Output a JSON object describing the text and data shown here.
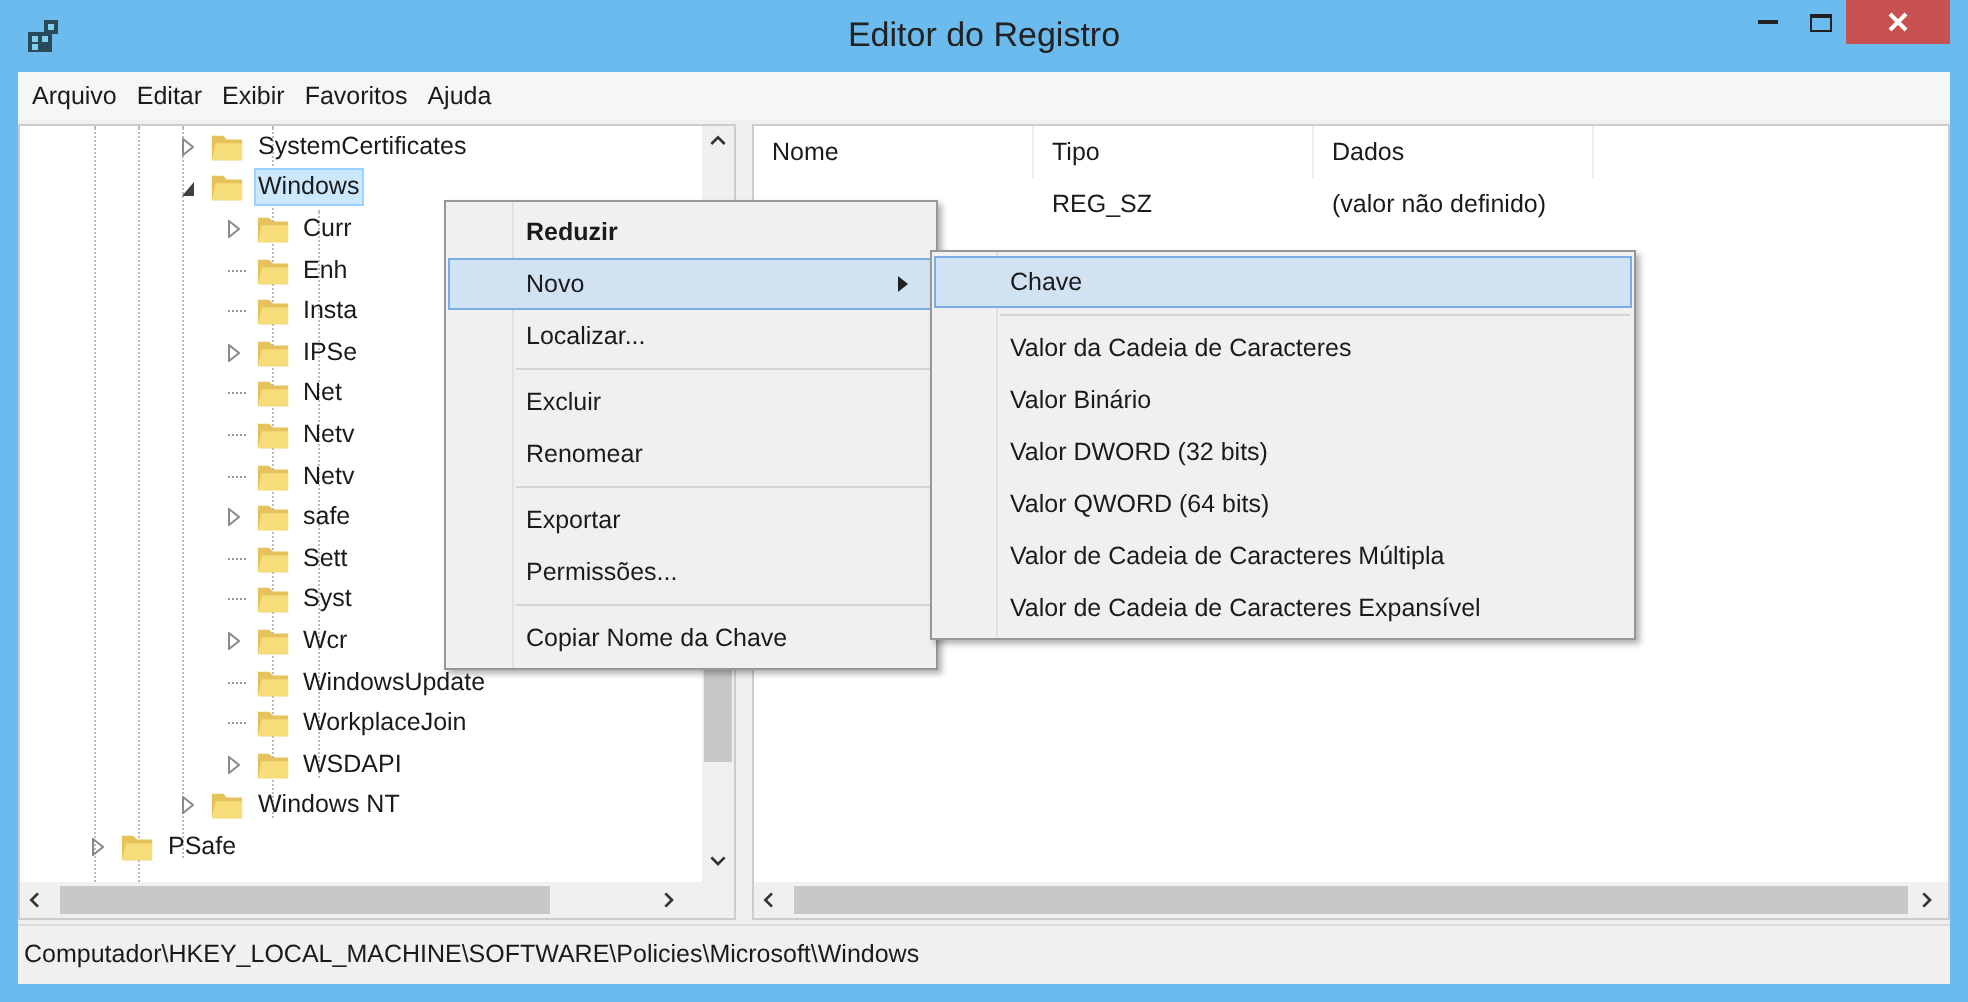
{
  "window": {
    "title": "Editor do Registro"
  },
  "menu_bar": [
    "Arquivo",
    "Editar",
    "Exibir",
    "Favoritos",
    "Ajuda"
  ],
  "tree": {
    "items": [
      {
        "label": "SystemCertificates",
        "has_children": true,
        "expanded": false,
        "selected": false
      },
      {
        "label": "Windows",
        "has_children": true,
        "expanded": true,
        "selected": true,
        "children": [
          {
            "label": "Curr",
            "has_children": true,
            "expanded": false,
            "selected": false
          },
          {
            "label": "Enh",
            "has_children": false,
            "selected": false
          },
          {
            "label": "Insta",
            "has_children": false,
            "selected": false
          },
          {
            "label": "IPSe",
            "has_children": true,
            "expanded": false,
            "selected": false
          },
          {
            "label": "Net",
            "has_children": false,
            "selected": false
          },
          {
            "label": "Netv",
            "has_children": false,
            "selected": false
          },
          {
            "label": "Netv",
            "has_children": false,
            "selected": false
          },
          {
            "label": "safe",
            "has_children": true,
            "expanded": false,
            "selected": false
          },
          {
            "label": "Sett",
            "has_children": false,
            "selected": false
          },
          {
            "label": "Syst",
            "has_children": false,
            "selected": false
          },
          {
            "label": "Wcr",
            "has_children": true,
            "expanded": false,
            "selected": false
          },
          {
            "label": "WindowsUpdate",
            "has_children": false,
            "selected": false
          },
          {
            "label": "WorkplaceJoin",
            "has_children": false,
            "selected": false
          },
          {
            "label": "WSDAPI",
            "has_children": true,
            "expanded": false,
            "selected": false
          }
        ]
      },
      {
        "label": "Windows NT",
        "has_children": true,
        "expanded": false,
        "selected": false
      }
    ],
    "outer_items": [
      {
        "label": "PSafe",
        "has_children": true,
        "expanded": false,
        "selected": false
      }
    ]
  },
  "values_table": {
    "columns": [
      "Nome",
      "Tipo",
      "Dados"
    ],
    "rows": [
      {
        "type": "REG_SZ",
        "data": "(valor não definido)"
      }
    ]
  },
  "context_menu": {
    "items": [
      {
        "kind": "item",
        "label": "Reduzir",
        "bold": true,
        "selected": false,
        "submenu": false
      },
      {
        "kind": "item",
        "label": "Novo",
        "bold": false,
        "selected": true,
        "submenu": true
      },
      {
        "kind": "item",
        "label": "Localizar...",
        "bold": false,
        "selected": false,
        "submenu": false
      },
      {
        "kind": "separator"
      },
      {
        "kind": "item",
        "label": "Excluir",
        "bold": false,
        "selected": false,
        "submenu": false
      },
      {
        "kind": "item",
        "label": "Renomear",
        "bold": false,
        "selected": false,
        "submenu": false
      },
      {
        "kind": "separator"
      },
      {
        "kind": "item",
        "label": "Exportar",
        "bold": false,
        "selected": false,
        "submenu": false
      },
      {
        "kind": "item",
        "label": "Permissões...",
        "bold": false,
        "selected": false,
        "submenu": false
      },
      {
        "kind": "separator"
      },
      {
        "kind": "item",
        "label": "Copiar Nome da Chave",
        "bold": false,
        "selected": false,
        "submenu": false
      }
    ]
  },
  "submenu": {
    "items": [
      {
        "kind": "item",
        "label": "Chave",
        "selected": true
      },
      {
        "kind": "separator"
      },
      {
        "kind": "item",
        "label": "Valor da Cadeia de Caracteres",
        "selected": false
      },
      {
        "kind": "item",
        "label": "Valor Binário",
        "selected": false
      },
      {
        "kind": "item",
        "label": "Valor DWORD (32 bits)",
        "selected": false
      },
      {
        "kind": "item",
        "label": "Valor QWORD (64 bits)",
        "selected": false
      },
      {
        "kind": "item",
        "label": "Valor de Cadeia de Caracteres Múltipla",
        "selected": false
      },
      {
        "kind": "item",
        "label": "Valor de Cadeia de Caracteres Expansível",
        "selected": false
      }
    ]
  },
  "status_bar": {
    "path": "Computador\\HKEY_LOCAL_MACHINE\\SOFTWARE\\Policies\\Microsoft\\Windows"
  }
}
